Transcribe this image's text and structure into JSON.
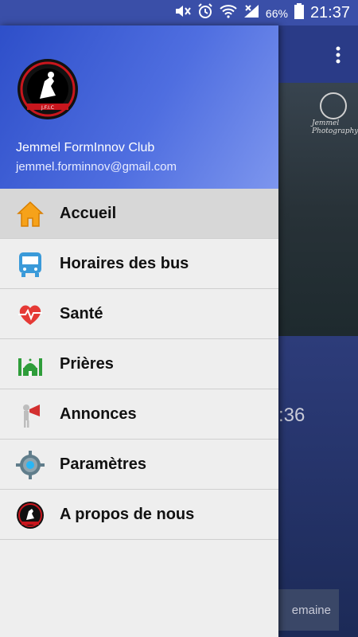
{
  "status_bar": {
    "battery": "66%",
    "time": "21:37"
  },
  "drawer": {
    "header": {
      "club_name": "Jemmel FormInnov Club",
      "email": "jemmel.forminnov@gmail.com"
    },
    "items": [
      {
        "label": "Accueil",
        "icon": "home-icon",
        "selected": true
      },
      {
        "label": "Horaires des bus",
        "icon": "bus-icon"
      },
      {
        "label": "Santé",
        "icon": "heart-icon"
      },
      {
        "label": "Prières",
        "icon": "mosque-icon"
      },
      {
        "label": "Annonces",
        "icon": "megaphone-icon"
      },
      {
        "label": "Paramètres",
        "icon": "gear-icon"
      },
      {
        "label": "A propos de nous",
        "icon": "club-logo-icon"
      }
    ]
  },
  "background": {
    "photo_caption_line1": "Jemmel",
    "photo_caption_line2": "Photography",
    "time_fragment": ":36",
    "button_fragment": "emaine"
  },
  "colors": {
    "header_start": "#2e4fc9",
    "header_end": "#7d96ee",
    "status_bar": "#3a4fa8",
    "selected_bg": "#d7d7d7"
  }
}
